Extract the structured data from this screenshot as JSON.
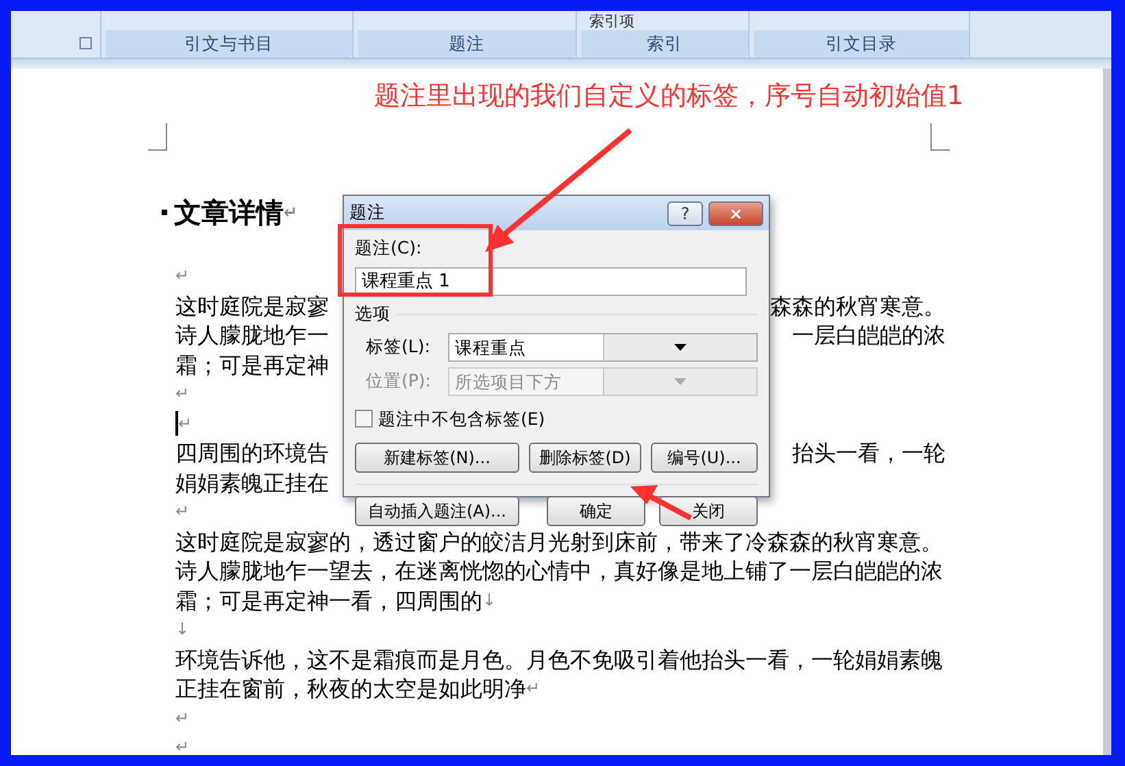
{
  "ribbon": {
    "partial_text": "索引项",
    "groups": [
      "引文与书目",
      "题注",
      "索引",
      "引文目录"
    ]
  },
  "annotation": {
    "text": "题注里出现的我们自定义的标签，序号自动初始值1"
  },
  "document": {
    "lines": [
      {
        "kind": "heading",
        "text": "文章详情",
        "end": "↵"
      },
      {
        "kind": "blank",
        "end": "↵"
      },
      {
        "kind": "split",
        "text": "这时庭院是寂寥",
        "right": "森森的秋宵寒意。"
      },
      {
        "kind": "split",
        "text": "诗人朦胧地乍一",
        "right": "一层白皑皑的浓"
      },
      {
        "kind": "split",
        "text": "霜；可是再定神"
      },
      {
        "kind": "blank",
        "end": "↵"
      },
      {
        "kind": "cursor",
        "end": "↵"
      },
      {
        "kind": "split",
        "text": "四周围的环境告",
        "right": "抬头一看，一轮"
      },
      {
        "kind": "split",
        "text": "娟娟素魄正挂在"
      },
      {
        "kind": "blank",
        "end": "↵"
      },
      {
        "kind": "text",
        "text": "这时庭院是寂寥的，透过窗户的皎洁月光射到床前，带来了冷森森的秋宵寒意。"
      },
      {
        "kind": "text",
        "text": "诗人朦胧地乍一望去，在迷离恍惚的心情中，真好像是地上铺了一层白皑皑的浓"
      },
      {
        "kind": "text",
        "text": "霜；可是再定神一看，四周围的",
        "end": "↓"
      },
      {
        "kind": "blank",
        "end": "↓"
      },
      {
        "kind": "text",
        "text": "环境告诉他，这不是霜痕而是月色。月色不免吸引着他抬头一看，一轮娟娟素魄"
      },
      {
        "kind": "text",
        "text": "正挂在窗前，秋夜的太空是如此明净",
        "end": "↵"
      },
      {
        "kind": "blank",
        "end": "↵"
      },
      {
        "kind": "blank",
        "end": "↵"
      }
    ]
  },
  "dialog": {
    "title": "题注",
    "help": "?",
    "close": "×",
    "caption_label": "题注(C):",
    "caption_value": "课程重点 1",
    "options_label": "选项",
    "fields": [
      {
        "label": "标签(L):",
        "value": "课程重点",
        "disabled": false
      },
      {
        "label": "位置(P):",
        "value": "所选项目下方",
        "disabled": true
      }
    ],
    "checkbox": {
      "label": "题注中不包含标签(E)",
      "checked": false
    },
    "buttons": [
      {
        "label": "新建标签(N)..."
      },
      {
        "label": "删除标签(D)"
      },
      {
        "label": "编号(U)..."
      }
    ],
    "bottom_buttons": [
      {
        "label": "自动插入题注(A)..."
      },
      {
        "label": "确定"
      },
      {
        "label": "关闭"
      }
    ]
  }
}
